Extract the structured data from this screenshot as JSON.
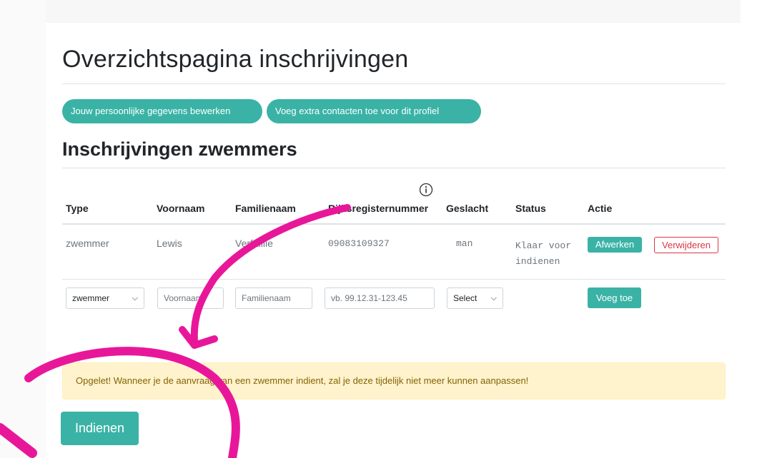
{
  "header": {
    "page_title": "Overzichtspagina inschrijvingen"
  },
  "actions": {
    "edit_personal": "Jouw persoonlijke gegevens bewerken",
    "add_contacts": "Voeg extra contacten toe voor dit profiel"
  },
  "section": {
    "title": "Inschrijvingen zwemmers"
  },
  "table": {
    "columns": [
      "Type",
      "Voornaam",
      "Familienaam",
      "Rijksregisternummer",
      "Geslacht",
      "Status",
      "Actie"
    ],
    "rows": [
      {
        "type": "zwemmer",
        "voornaam": "Lewis",
        "familienaam": "Verfaillie",
        "rijksregisternummer": "09083109327",
        "geslacht": "man",
        "status": "Klaar voor indienen",
        "action_complete": "Afwerken",
        "action_delete": "Verwijderen"
      }
    ],
    "new_row": {
      "type_value": "zwemmer",
      "voornaam_placeholder": "Voornaam",
      "familienaam_placeholder": "Familienaam",
      "rijksregister_placeholder": "vb. 99.12.31-123.45",
      "geslacht_value": "Select",
      "add_label": "Voeg toe"
    }
  },
  "alert": {
    "text": "Opgelet! Wanneer je de aanvraag van een zwemmer indient, zal je deze tijdelijk niet meer kunnen aanpassen!"
  },
  "submit": {
    "label": "Indienen"
  },
  "icons": {
    "info": "info-icon",
    "chevron": "chevron-down-icon"
  },
  "colors": {
    "accent": "#3ab3a6",
    "danger": "#dc3545",
    "warning_bg": "#fff3cd",
    "annotation": "#e8179a"
  }
}
